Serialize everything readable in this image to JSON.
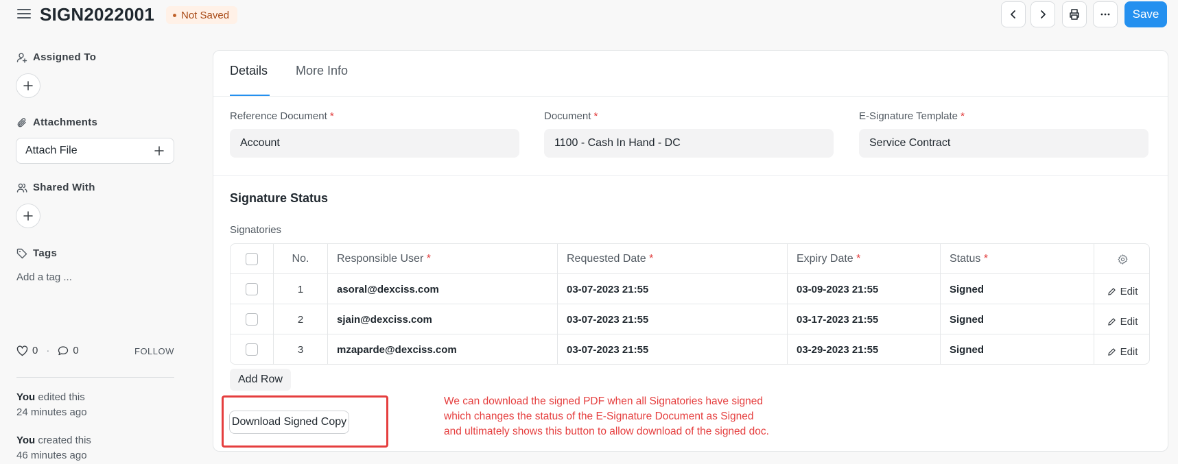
{
  "header": {
    "title": "SIGN2022001",
    "status": "Not Saved",
    "save_label": "Save"
  },
  "sidebar": {
    "assigned_to_label": "Assigned To",
    "attachments_label": "Attachments",
    "attach_file_label": "Attach File",
    "shared_with_label": "Shared With",
    "tags_label": "Tags",
    "add_tag_placeholder": "Add a tag ...",
    "likes_count": "0",
    "comments_count": "0",
    "separator": "·",
    "follow_label": "FOLLOW",
    "activity": [
      {
        "actor": "You",
        "action": "edited this",
        "time": "24 minutes ago"
      },
      {
        "actor": "You",
        "action": "created this",
        "time": "46 minutes ago"
      }
    ]
  },
  "tabs": {
    "details": "Details",
    "more_info": "More Info"
  },
  "fields": {
    "reference_document": {
      "label": "Reference Document",
      "value": "Account"
    },
    "document": {
      "label": "Document",
      "value": "1100 - Cash In Hand - DC"
    },
    "template": {
      "label": "E-Signature Template",
      "value": "Service Contract"
    },
    "required_mark": "*"
  },
  "signature_section": {
    "title": "Signature Status",
    "table_label": "Signatories",
    "columns": {
      "no": "No.",
      "user": "Responsible User",
      "requested": "Requested Date",
      "expiry": "Expiry Date",
      "status": "Status"
    },
    "rows": [
      {
        "no": "1",
        "user": "asoral@dexciss.com",
        "requested": "03-07-2023 21:55",
        "expiry": "03-09-2023 21:55",
        "status": "Signed",
        "edit": "Edit"
      },
      {
        "no": "2",
        "user": "sjain@dexciss.com",
        "requested": "03-07-2023 21:55",
        "expiry": "03-17-2023 21:55",
        "status": "Signed",
        "edit": "Edit"
      },
      {
        "no": "3",
        "user": "mzaparde@dexciss.com",
        "requested": "03-07-2023 21:55",
        "expiry": "03-29-2023 21:55",
        "status": "Signed",
        "edit": "Edit"
      }
    ],
    "add_row_label": "Add Row",
    "download_label": "Download Signed Copy"
  },
  "annotation": {
    "line1": "We can download the signed PDF when all Signatories have signed",
    "line2": "which changes the status of the E-Signature Document as Signed",
    "line3": "and ultimately shows this button to allow download of the signed doc."
  },
  "colors": {
    "primary": "#2490ef",
    "annotation_red": "#e53e3e",
    "not_saved_text": "#a84a16",
    "not_saved_bg": "#fff1e7"
  }
}
